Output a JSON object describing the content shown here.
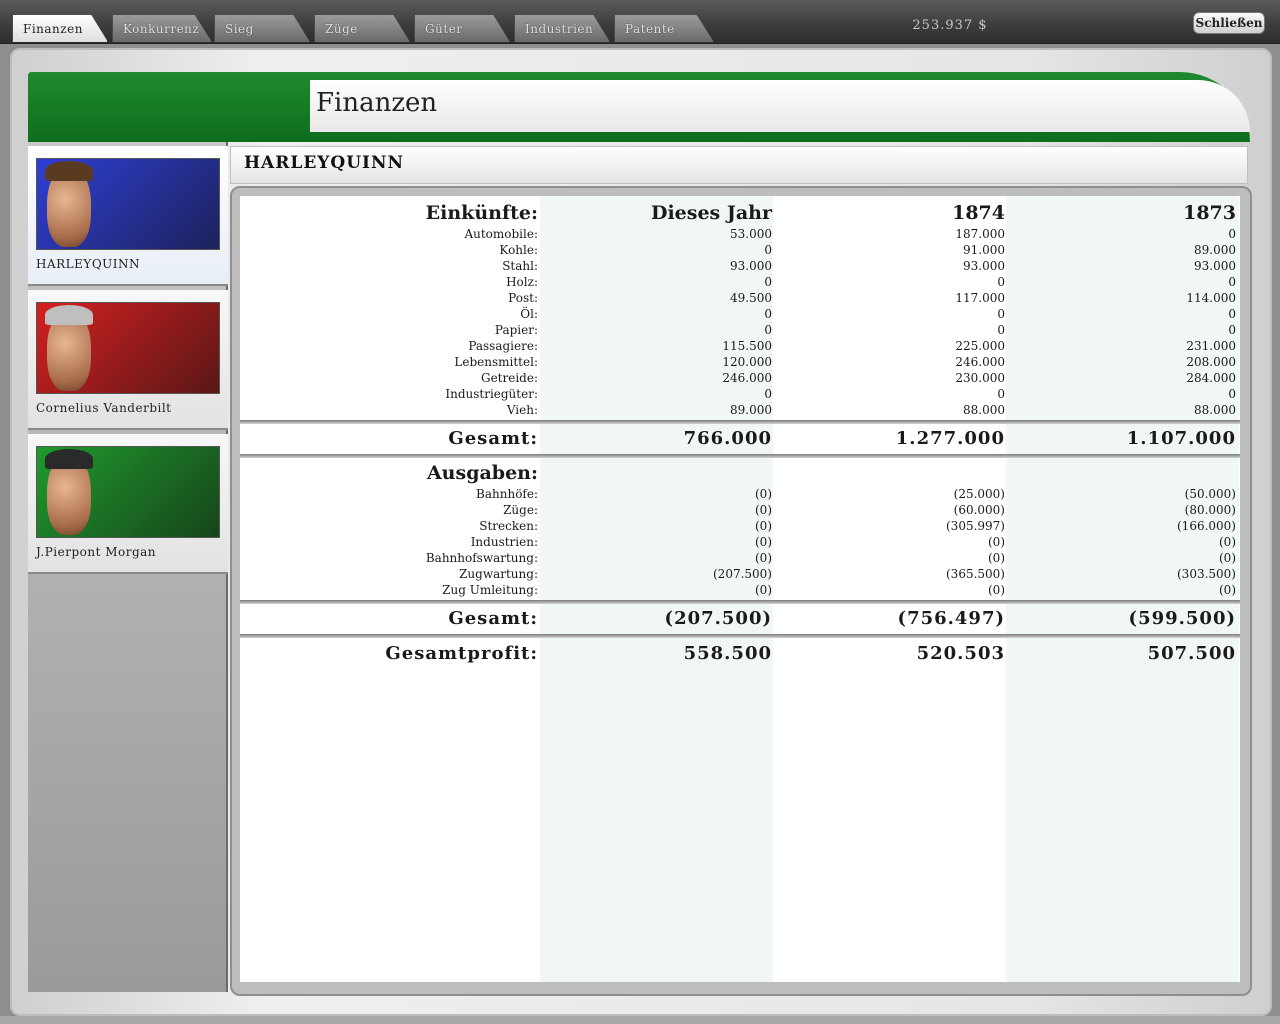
{
  "tabs": [
    {
      "label": "Finanzen"
    },
    {
      "label": "Konkurrenz"
    },
    {
      "label": "Sieg"
    },
    {
      "label": "Züge"
    },
    {
      "label": "Güter"
    },
    {
      "label": "Industrien"
    },
    {
      "label": "Patente"
    }
  ],
  "money": "253.937 $",
  "close_label": "Schließen",
  "page_title": "Finanzen",
  "company_name": "HARLEYQUINN",
  "players": [
    {
      "name": "HARLEYQUINN",
      "bg_color": "#2f3fd6",
      "selected": true
    },
    {
      "name": "Cornelius Vanderbilt",
      "bg_color": "#d42020",
      "selected": false
    },
    {
      "name": "J.Pierpont Morgan",
      "bg_color": "#1f9a2c",
      "selected": false
    }
  ],
  "columns": {
    "label": "Einkünfte:",
    "current": "Dieses Jahr",
    "prev1": "1874",
    "prev2": "1873"
  },
  "income": [
    {
      "label": "Automobile:",
      "v1": "53.000",
      "v2": "187.000",
      "v3": "0"
    },
    {
      "label": "Kohle:",
      "v1": "0",
      "v2": "91.000",
      "v3": "89.000"
    },
    {
      "label": "Stahl:",
      "v1": "93.000",
      "v2": "93.000",
      "v3": "93.000"
    },
    {
      "label": "Holz:",
      "v1": "0",
      "v2": "0",
      "v3": "0"
    },
    {
      "label": "Post:",
      "v1": "49.500",
      "v2": "117.000",
      "v3": "114.000"
    },
    {
      "label": "Öl:",
      "v1": "0",
      "v2": "0",
      "v3": "0"
    },
    {
      "label": "Papier:",
      "v1": "0",
      "v2": "0",
      "v3": "0"
    },
    {
      "label": "Passagiere:",
      "v1": "115.500",
      "v2": "225.000",
      "v3": "231.000"
    },
    {
      "label": "Lebensmittel:",
      "v1": "120.000",
      "v2": "246.000",
      "v3": "208.000"
    },
    {
      "label": "Getreide:",
      "v1": "246.000",
      "v2": "230.000",
      "v3": "284.000"
    },
    {
      "label": "Industriegüter:",
      "v1": "0",
      "v2": "0",
      "v3": "0"
    },
    {
      "label": "Vieh:",
      "v1": "89.000",
      "v2": "88.000",
      "v3": "88.000"
    }
  ],
  "income_total": {
    "label": "Gesamt:",
    "v1": "766.000",
    "v2": "1.277.000",
    "v3": "1.107.000"
  },
  "expenses_heading": "Ausgaben:",
  "expenses": [
    {
      "label": "Bahnhöfe:",
      "v1": "(0)",
      "v2": "(25.000)",
      "v3": "(50.000)"
    },
    {
      "label": "Züge:",
      "v1": "(0)",
      "v2": "(60.000)",
      "v3": "(80.000)"
    },
    {
      "label": "Strecken:",
      "v1": "(0)",
      "v2": "(305.997)",
      "v3": "(166.000)"
    },
    {
      "label": "Industrien:",
      "v1": "(0)",
      "v2": "(0)",
      "v3": "(0)"
    },
    {
      "label": "Bahnhofswartung:",
      "v1": "(0)",
      "v2": "(0)",
      "v3": "(0)"
    },
    {
      "label": "Zugwartung:",
      "v1": "(207.500)",
      "v2": "(365.500)",
      "v3": "(303.500)"
    },
    {
      "label": "Zug Umleitung:",
      "v1": "(0)",
      "v2": "(0)",
      "v3": "(0)"
    }
  ],
  "expenses_total": {
    "label": "Gesamt:",
    "v1": "(207.500)",
    "v2": "(756.497)",
    "v3": "(599.500)"
  },
  "profit": {
    "label": "Gesamtprofit:",
    "v1": "558.500",
    "v2": "520.503",
    "v3": "507.500"
  }
}
